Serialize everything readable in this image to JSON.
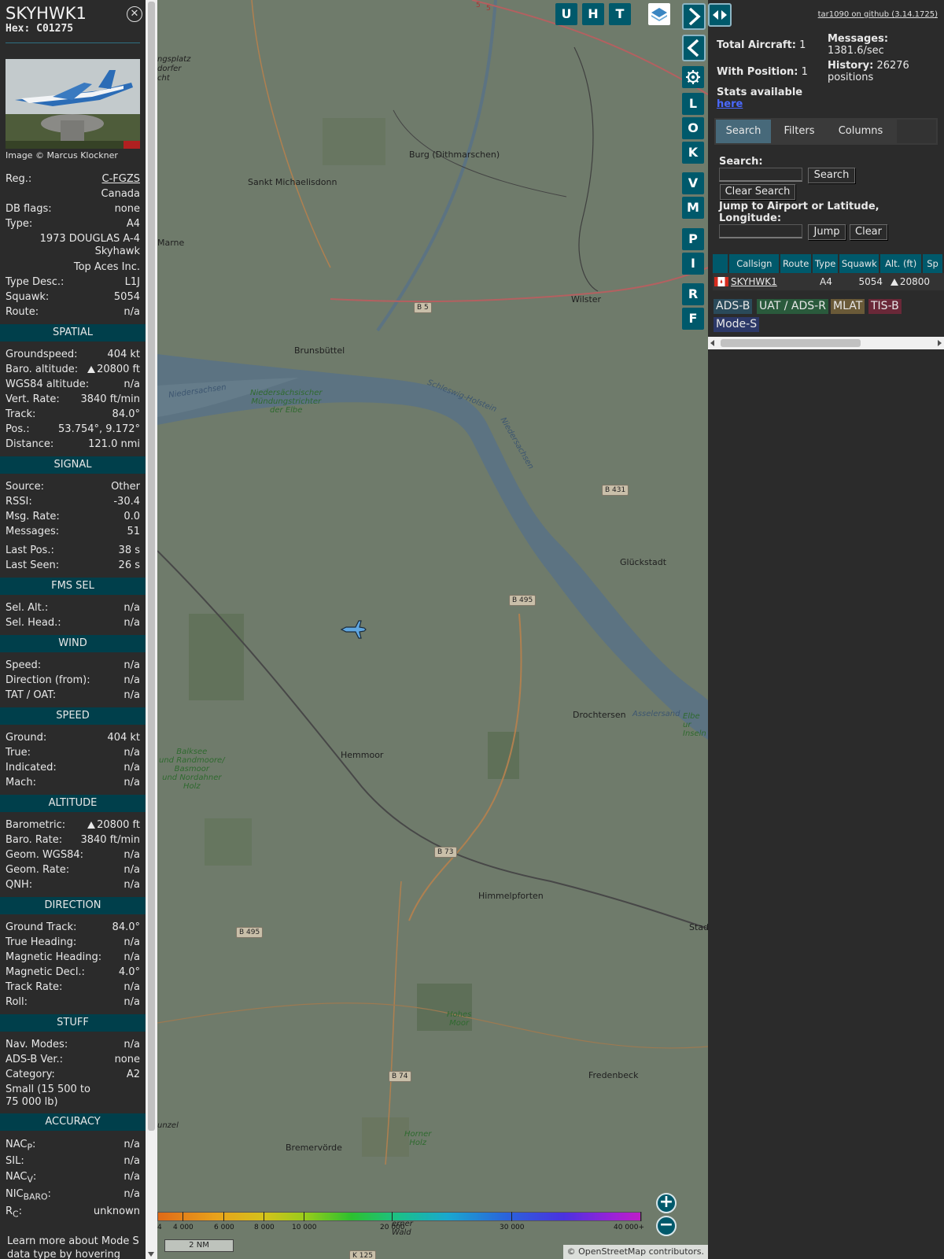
{
  "info": {
    "callsign": "SKYHWK1",
    "hex_label": "Hex:",
    "hex": "C01275",
    "photo_credit": "Image © Marcus Klockner",
    "reg_label": "Reg.:",
    "reg": "C-FGZS",
    "country": "Canada",
    "dbflags_label": "DB flags:",
    "dbflags": "none",
    "type_label": "Type:",
    "type": "A4",
    "type_full_1": "1973 DOUGLAS A-4",
    "type_full_2": "Skyhawk",
    "owner": "Top Aces Inc.",
    "typedesc_label": "Type Desc.:",
    "typedesc": "L1J",
    "squawk_label": "Squawk:",
    "squawk": "5054",
    "route_label": "Route:",
    "route": "n/a"
  },
  "sections": {
    "spatial": "SPATIAL",
    "signal": "SIGNAL",
    "fms": "FMS SEL",
    "wind": "WIND",
    "speed": "SPEED",
    "altitude": "ALTITUDE",
    "direction": "DIRECTION",
    "stuff": "STUFF",
    "accuracy": "ACCURACY"
  },
  "spatial": {
    "gs_label": "Groundspeed:",
    "gs": "404 kt",
    "baro_label": "Baro. altitude:",
    "baro": "20800 ft",
    "wgs_label": "WGS84 altitude:",
    "wgs": "n/a",
    "vr_label": "Vert. Rate:",
    "vr": "3840 ft/min",
    "track_label": "Track:",
    "track": "84.0°",
    "pos_label": "Pos.:",
    "pos": "53.754°, 9.172°",
    "dist_label": "Distance:",
    "dist": "121.0 nmi"
  },
  "signal": {
    "source_label": "Source:",
    "source": "Other",
    "rssi_label": "RSSI:",
    "rssi": "-30.4",
    "msgrate_label": "Msg. Rate:",
    "msgrate": "0.0",
    "messages_label": "Messages:",
    "messages": "51",
    "lastpos_label": "Last Pos.:",
    "lastpos": "38 s",
    "lastseen_label": "Last Seen:",
    "lastseen": "26 s"
  },
  "fms": {
    "selalt_label": "Sel. Alt.:",
    "selalt": "n/a",
    "selhead_label": "Sel. Head.:",
    "selhead": "n/a"
  },
  "wind": {
    "speed_label": "Speed:",
    "speed": "n/a",
    "dir_label": "Direction (from):",
    "dir": "n/a",
    "tat_label": "TAT / OAT:",
    "tat": "n/a"
  },
  "speed": {
    "ground_label": "Ground:",
    "ground": "404 kt",
    "true_label": "True:",
    "true": "n/a",
    "ind_label": "Indicated:",
    "ind": "n/a",
    "mach_label": "Mach:",
    "mach": "n/a"
  },
  "altitude": {
    "baro_label": "Barometric:",
    "baro": "20800 ft",
    "rate_label": "Baro. Rate:",
    "rate": "3840 ft/min",
    "geom_label": "Geom. WGS84:",
    "geom": "n/a",
    "georate_label": "Geom. Rate:",
    "georate": "n/a",
    "qnh_label": "QNH:",
    "qnh": "n/a"
  },
  "direction": {
    "gt_label": "Ground Track:",
    "gt": "84.0°",
    "th_label": "True Heading:",
    "th": "n/a",
    "mh_label": "Magnetic Heading:",
    "mh": "n/a",
    "md_label": "Magnetic Decl.:",
    "md": "4.0°",
    "tr_label": "Track Rate:",
    "tr": "n/a",
    "roll_label": "Roll:",
    "roll": "n/a"
  },
  "stuff": {
    "nav_label": "Nav. Modes:",
    "nav": "n/a",
    "adsb_label": "ADS-B Ver.:",
    "adsb": "none",
    "cat_label": "Category:",
    "cat": "A2",
    "cat_desc_1": "Small (15 500 to",
    "cat_desc_2": "75 000 lb)"
  },
  "accuracy": {
    "nacp_label": "NAC",
    "nacp_sub": "P",
    "nacp": "n/a",
    "sil_label": "SIL:",
    "sil": "n/a",
    "nacv_label": "NAC",
    "nacv_sub": "V",
    "nacv": "n/a",
    "nicbaro_label": "NIC",
    "nicbaro_sub": "BARO",
    "nicbaro": "n/a",
    "rc_label": "R",
    "rc_sub": "C",
    "rc": "unknown"
  },
  "footer_note_1": "Learn more about Mode S",
  "footer_note_2": "data type by hovering over",
  "map": {
    "buttons": [
      "U",
      "H",
      "T"
    ],
    "side_buttons": [
      "L",
      "O",
      "K",
      "V",
      "M",
      "P",
      "I",
      "R",
      "F"
    ],
    "places": {
      "burg": "Burg (Dithmarschen)",
      "michaelisdonn": "Sankt Michaelisdonn",
      "marne": "Marne",
      "wilster": "Wilster",
      "brunsbuettel": "Brunsbüttel",
      "glueckstadt": "Glückstadt",
      "drochtersen": "Drochtersen",
      "hemmoor": "Hemmoor",
      "himmelpforten": "Himmelpforten",
      "fredenbeck": "Fredenbeck",
      "bremervoerde": "Bremervörde",
      "stade": "Stad",
      "ingsplatz": "ngsplatz",
      "dorfer": "dorfer",
      "cht": "cht",
      "asselersand": "Asselersand",
      "elbe_ins_1": "Elbe ur",
      "elbe_ins_2": "Inseln",
      "unzel": "unzel",
      "wald": "erner",
      "wald2": "Wald"
    },
    "water": {
      "niedersachsen_1": "Niedersachsen",
      "niedersachsen_2": "Niedersachsen",
      "schleswig": "Schleswig-Holstein",
      "elbe_1": "Niedersächsischer",
      "elbe_2": "Mündungstrichter",
      "elbe_3": "der Elbe"
    },
    "green": {
      "balksee_1": "Balksee",
      "balksee_2": "und Randmoore/",
      "balksee_3": "Basmoor",
      "balksee_4": "und Nordahner",
      "balksee_5": "Holz",
      "hohes_1": "Hohes",
      "hohes_2": "Moor",
      "horner_1": "Horner",
      "horner_2": "Holz"
    },
    "roads": {
      "b5": "B 5",
      "b431": "B 431",
      "b495a": "B 495",
      "b495b": "B 495",
      "b73": "B 73",
      "b74": "B 74",
      "k125": "K 125",
      "five1": "5",
      "five2": "5"
    },
    "altitude_labels": [
      "4",
      "4 000",
      "6 000",
      "8 000",
      "10 000",
      "20 000",
      "30 000",
      "40 000+"
    ],
    "scale": "2 NM",
    "attribution": "© OpenStreetMap contributors."
  },
  "sidebar": {
    "version": "tar1090 on github (3.14.1725)",
    "total_label": "Total Aircraft:",
    "total": "1",
    "withpos_label": "With Position:",
    "withpos": "1",
    "messages_label": "Messages:",
    "messages": "1381.6/sec",
    "history_label": "History:",
    "history": "26276",
    "history_unit": "positions",
    "stats_label": "Stats available",
    "stats_link": "here",
    "tabs": [
      "Search",
      "Filters",
      "Columns"
    ],
    "search_label": "Search:",
    "search_btn": "Search",
    "clear_search_btn": "Clear Search",
    "jump_label_1": "Jump to Airport or Latitude,",
    "jump_label_2": "Longitude:",
    "jump_btn": "Jump",
    "clear_btn": "Clear",
    "table": {
      "headers": [
        "",
        "Callsign",
        "Route",
        "Type",
        "Squawk",
        "Alt. (ft)",
        "Sp"
      ],
      "row": {
        "callsign": "SKYHWK1",
        "route": "",
        "type": "A4",
        "squawk": "5054",
        "alt": "20800"
      }
    },
    "sources": [
      "ADS-B",
      "UAT / ADS-R",
      "MLAT",
      "TIS-B",
      "Mode-S"
    ]
  },
  "colors": {
    "accent": "#00596b",
    "section": "#003f4b",
    "adsb": "#2a4a5a",
    "uat": "#2a5a3c",
    "mlat": "#6a5a38",
    "tisb": "#6a2838",
    "modes": "#2c3868"
  }
}
